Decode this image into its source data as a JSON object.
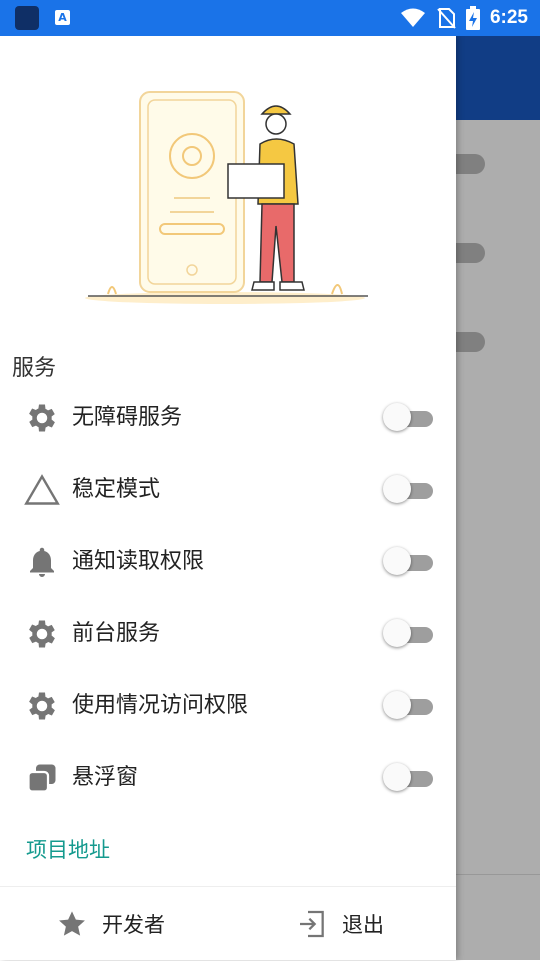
{
  "status_bar": {
    "time": "6:25",
    "notification_icon_letter": "A"
  },
  "drawer": {
    "section_title": "服务",
    "items": [
      {
        "label": "无障碍服务",
        "icon": "gear-icon",
        "enabled": false
      },
      {
        "label": "稳定模式",
        "icon": "triangle-icon",
        "enabled": false
      },
      {
        "label": "通知读取权限",
        "icon": "bell-icon",
        "enabled": false
      },
      {
        "label": "前台服务",
        "icon": "gear-icon",
        "enabled": false
      },
      {
        "label": "使用情况访问权限",
        "icon": "gear-icon",
        "enabled": false
      },
      {
        "label": "悬浮窗",
        "icon": "overlay-windows-icon",
        "enabled": false
      }
    ],
    "project_link": "项目地址",
    "footer": {
      "developer_label": "开发者",
      "exit_label": "退出"
    }
  },
  "colors": {
    "status_bar": "#1a73e8",
    "app_bar": "#1a5bc4",
    "link": "#149a8e",
    "illustration_accent": "#f5c842"
  }
}
